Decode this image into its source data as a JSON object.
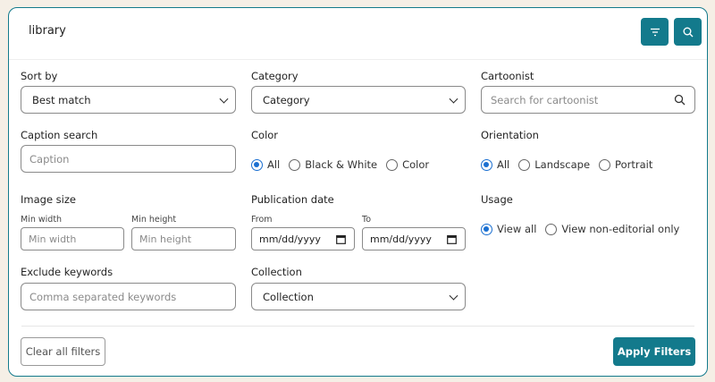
{
  "search": {
    "query": "library"
  },
  "toolbar": {
    "filter_icon": "filter-icon",
    "search_icon": "search-icon"
  },
  "filters": {
    "sort_by": {
      "label": "Sort by",
      "value": "Best match"
    },
    "category": {
      "label": "Category",
      "value": "Category"
    },
    "cartoonist": {
      "label": "Cartoonist",
      "placeholder": "Search for cartoonist"
    },
    "caption": {
      "label": "Caption search",
      "placeholder": "Caption"
    },
    "color": {
      "label": "Color",
      "options": [
        "All",
        "Black & White",
        "Color"
      ],
      "selected": "All"
    },
    "orientation": {
      "label": "Orientation",
      "options": [
        "All",
        "Landscape",
        "Portrait"
      ],
      "selected": "All"
    },
    "image_size": {
      "label": "Image size",
      "min_width_label": "Min width",
      "min_width_placeholder": "Min width",
      "min_height_label": "Min height",
      "min_height_placeholder": "Min height"
    },
    "publication_date": {
      "label": "Publication date",
      "from_label": "From",
      "to_label": "To",
      "from_value": "mm/dd/yyyy",
      "to_value": "mm/dd/yyyy"
    },
    "usage": {
      "label": "Usage",
      "options": [
        "View all",
        "View non-editorial only"
      ],
      "selected": "View all"
    },
    "exclude": {
      "label": "Exclude keywords",
      "placeholder": "Comma separated keywords"
    },
    "collection": {
      "label": "Collection",
      "value": "Collection"
    }
  },
  "actions": {
    "clear": "Clear all filters",
    "apply": "Apply Filters"
  },
  "colors": {
    "accent": "#137a8c",
    "radio": "#1a6fd1",
    "background": "#f5efe6"
  }
}
